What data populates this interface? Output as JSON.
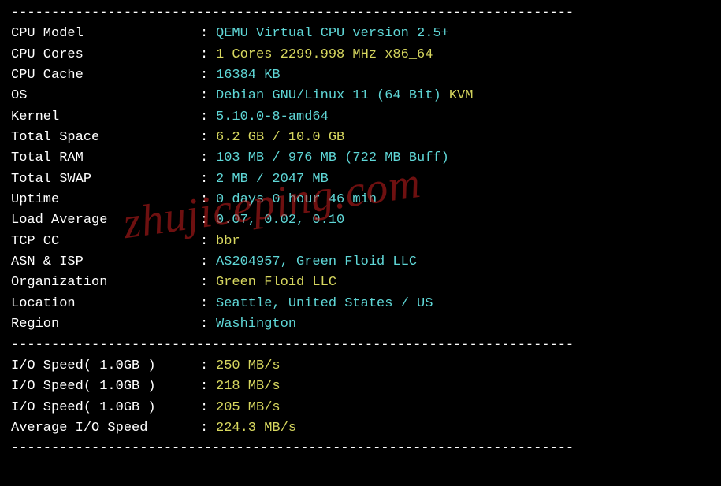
{
  "divider": "----------------------------------------------------------------------",
  "watermark": "zhujiceping.com",
  "sysinfo": [
    {
      "label": "CPU Model           ",
      "segments": [
        {
          "text": "QEMU Virtual CPU version 2.5+",
          "cls": "cyan"
        }
      ]
    },
    {
      "label": "CPU Cores           ",
      "segments": [
        {
          "text": "1 Cores 2299.998 MHz x86_64",
          "cls": "yellow"
        }
      ]
    },
    {
      "label": "CPU Cache           ",
      "segments": [
        {
          "text": "16384 KB",
          "cls": "cyan"
        }
      ]
    },
    {
      "label": "OS                  ",
      "segments": [
        {
          "text": "Debian GNU/Linux 11 (64 Bit) ",
          "cls": "cyan"
        },
        {
          "text": "KVM",
          "cls": "yellow"
        }
      ]
    },
    {
      "label": "Kernel              ",
      "segments": [
        {
          "text": "5.10.0-8-amd64",
          "cls": "cyan"
        }
      ]
    },
    {
      "label": "Total Space         ",
      "segments": [
        {
          "text": "6.2 GB / 10.0 GB",
          "cls": "yellow"
        }
      ]
    },
    {
      "label": "Total RAM           ",
      "segments": [
        {
          "text": "103 MB / 976 MB (722 MB Buff)",
          "cls": "cyan"
        }
      ]
    },
    {
      "label": "Total SWAP          ",
      "segments": [
        {
          "text": "2 MB / 2047 MB",
          "cls": "cyan"
        }
      ]
    },
    {
      "label": "Uptime              ",
      "segments": [
        {
          "text": "0 days 0 hour 46 min",
          "cls": "cyan"
        }
      ]
    },
    {
      "label": "Load Average        ",
      "segments": [
        {
          "text": "0.07, 0.02, 0.10",
          "cls": "cyan"
        }
      ]
    },
    {
      "label": "TCP CC              ",
      "segments": [
        {
          "text": "bbr",
          "cls": "yellow"
        }
      ]
    },
    {
      "label": "ASN & ISP           ",
      "segments": [
        {
          "text": "AS204957, Green Floid LLC",
          "cls": "cyan"
        }
      ]
    },
    {
      "label": "Organization        ",
      "segments": [
        {
          "text": "Green Floid LLC",
          "cls": "yellow"
        }
      ]
    },
    {
      "label": "Location            ",
      "segments": [
        {
          "text": "Seattle, United States / US",
          "cls": "cyan"
        }
      ]
    },
    {
      "label": "Region              ",
      "segments": [
        {
          "text": "Washington",
          "cls": "cyan"
        }
      ]
    }
  ],
  "iospeed": [
    {
      "label": "I/O Speed( 1.0GB )  ",
      "segments": [
        {
          "text": "250 MB/s",
          "cls": "yellow"
        }
      ]
    },
    {
      "label": "I/O Speed( 1.0GB )  ",
      "segments": [
        {
          "text": "218 MB/s",
          "cls": "yellow"
        }
      ]
    },
    {
      "label": "I/O Speed( 1.0GB )  ",
      "segments": [
        {
          "text": "205 MB/s",
          "cls": "yellow"
        }
      ]
    },
    {
      "label": "Average I/O Speed   ",
      "segments": [
        {
          "text": "224.3 MB/s",
          "cls": "yellow"
        }
      ]
    }
  ]
}
